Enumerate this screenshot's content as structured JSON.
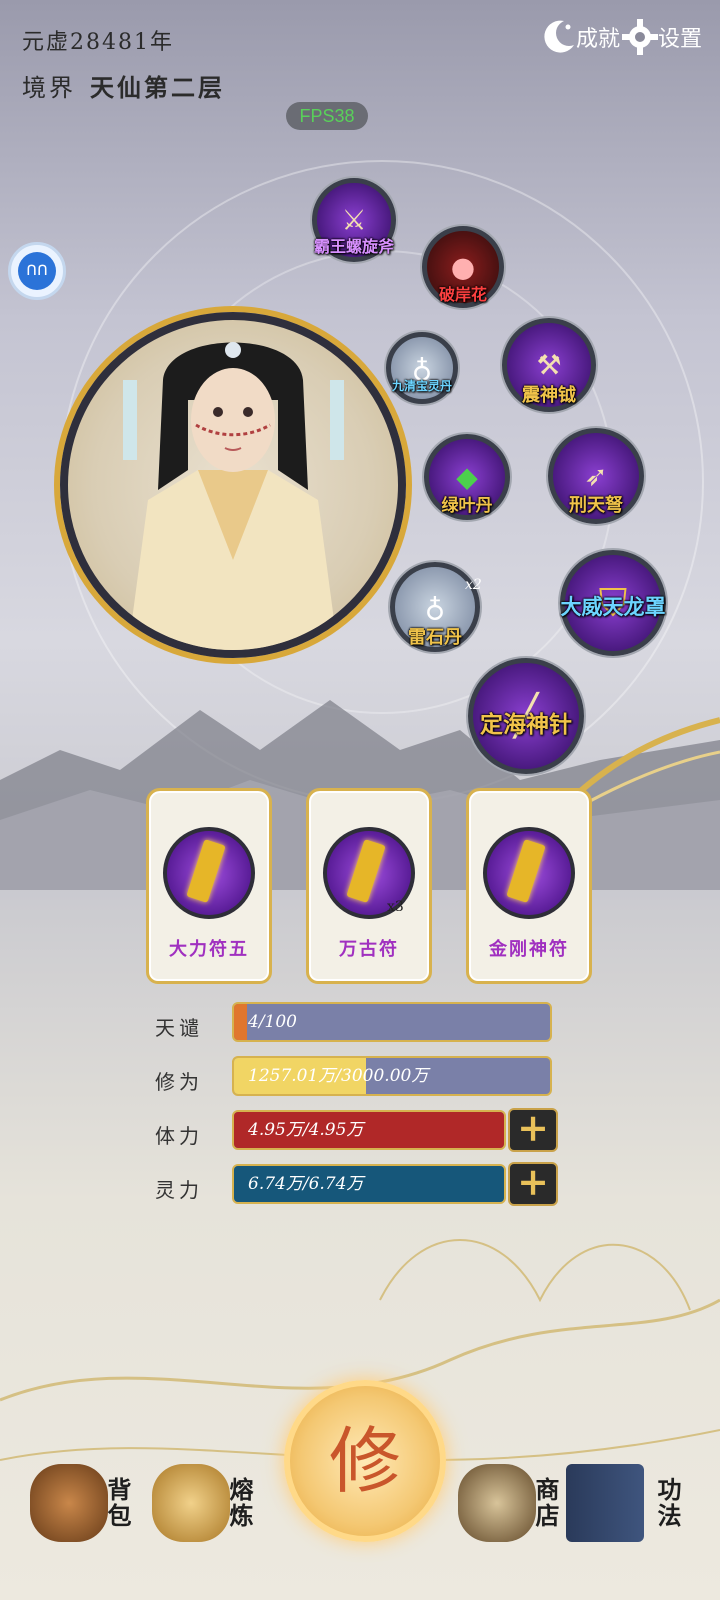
{
  "header": {
    "era": "元虚28481年",
    "realm_label": "境界",
    "realm_value": "天仙第二层",
    "fps": "FPS38",
    "achievements_label": "成就",
    "settings_label": "设置"
  },
  "float_button": {
    "label": "∩∩"
  },
  "equipment": [
    {
      "name": "霸王螺旋斧"
    },
    {
      "name": "破岸花"
    },
    {
      "name": "九清宝灵丹"
    },
    {
      "name": "震神钺"
    },
    {
      "name": "绿叶丹"
    },
    {
      "name": "刑天弩"
    },
    {
      "name": "雷石丹",
      "count": "x2"
    },
    {
      "name": "大威天龙罩"
    },
    {
      "name": "定海神针"
    }
  ],
  "talismans": [
    {
      "name": "大力符五"
    },
    {
      "name": "万古符",
      "count": "x3"
    },
    {
      "name": "金刚神符"
    }
  ],
  "stats": {
    "tianqian": {
      "label": "天谴",
      "value": "4/100",
      "fraction": 0.04,
      "color": "#e0762e"
    },
    "xiuwei": {
      "label": "修为",
      "value": "1257.01万/3000.00万",
      "fraction": 0.419,
      "color": "#f1d564"
    },
    "tili": {
      "label": "体力",
      "value": "4.95万/4.95万",
      "fraction": 1.0,
      "color": "#b02828"
    },
    "lingli": {
      "label": "灵力",
      "value": "6.74万/6.74万",
      "fraction": 1.0,
      "color": "#16577a"
    }
  },
  "nav": {
    "bag": "背包",
    "smelt": "熔炼",
    "cultivate": "修",
    "shop": "商店",
    "skills": "功法"
  }
}
